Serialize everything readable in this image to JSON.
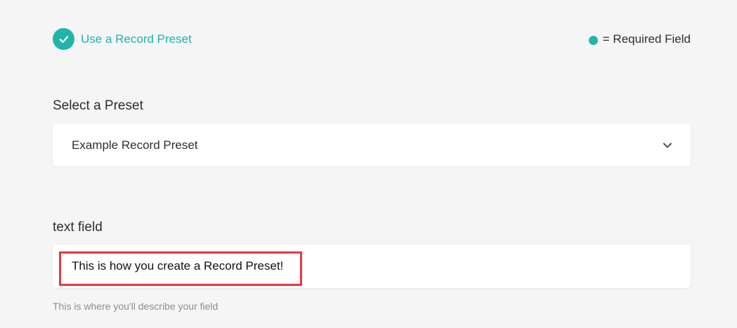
{
  "preset_toggle": {
    "label": "Use a Record Preset",
    "checked": true
  },
  "legend": {
    "text": "= Required Field",
    "dot_color": "#1fb5a8"
  },
  "preset_select": {
    "label": "Select a Preset",
    "value": "Example Record Preset",
    "icon": "chevron-down-icon"
  },
  "text_field": {
    "label": "text field",
    "value": "This is how you create a Record Preset!",
    "helper": "This is where you'll describe your field"
  },
  "colors": {
    "accent": "#1fb5a8",
    "highlight": "#e5393d",
    "background": "#f5f5f5"
  }
}
